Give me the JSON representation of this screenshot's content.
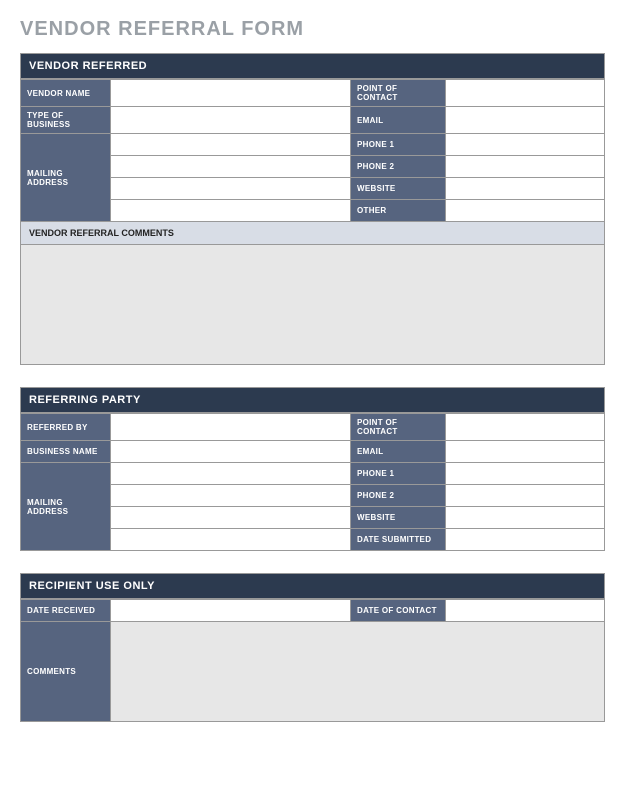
{
  "title": "VENDOR REFERRAL FORM",
  "sections": {
    "vendor": {
      "header": "VENDOR REFERRED",
      "rows": {
        "vendor_name": "VENDOR NAME",
        "point_of_contact": "POINT OF CONTACT",
        "type_of_business": "TYPE OF BUSINESS",
        "email": "EMAIL",
        "mailing_address": "MAILING ADDRESS",
        "phone1": "PHONE 1",
        "phone2": "PHONE 2",
        "website": "WEBSITE",
        "other": "OTHER"
      },
      "comments_header": "VENDOR REFERRAL COMMENTS",
      "values": {
        "vendor_name": "",
        "point_of_contact": "",
        "type_of_business": "",
        "email": "",
        "mailing_address1": "",
        "mailing_address2": "",
        "mailing_address3": "",
        "mailing_address4": "",
        "phone1": "",
        "phone2": "",
        "website": "",
        "other": "",
        "comments": ""
      }
    },
    "referring": {
      "header": "REFERRING PARTY",
      "rows": {
        "referred_by": "REFERRED BY",
        "point_of_contact": "POINT OF CONTACT",
        "business_name": "BUSINESS NAME",
        "email": "EMAIL",
        "mailing_address": "MAILING ADDRESS",
        "phone1": "PHONE 1",
        "phone2": "PHONE 2",
        "website": "WEBSITE",
        "date_submitted": "DATE SUBMITTED"
      },
      "values": {
        "referred_by": "",
        "point_of_contact": "",
        "business_name": "",
        "email": "",
        "mailing_address1": "",
        "mailing_address2": "",
        "mailing_address3": "",
        "mailing_address4": "",
        "phone1": "",
        "phone2": "",
        "website": "",
        "date_submitted": ""
      }
    },
    "recipient": {
      "header": "RECIPIENT USE ONLY",
      "rows": {
        "date_received": "DATE RECEIVED",
        "date_of_contact": "DATE OF CONTACT",
        "comments": "COMMENTS"
      },
      "values": {
        "date_received": "",
        "date_of_contact": "",
        "comments": ""
      }
    }
  }
}
